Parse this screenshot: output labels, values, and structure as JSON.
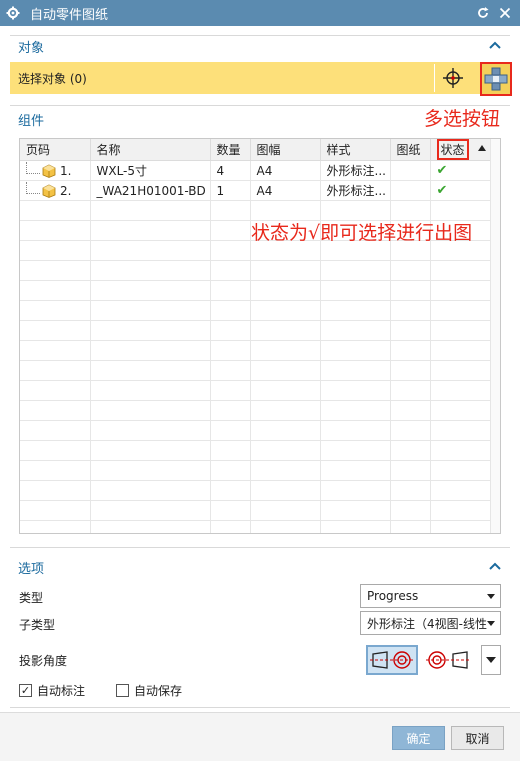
{
  "window": {
    "title": "自动零件图纸",
    "gear_icon": "gear-icon",
    "reset_icon": "reset-icon",
    "close_icon": "close-icon"
  },
  "object_section": {
    "label": "对象",
    "select_label": "选择对象 (0)"
  },
  "annotations": {
    "multi_select": "多选按钮",
    "status_hint": "状态为√即可选择进行出图"
  },
  "component_section": {
    "label": "组件",
    "columns": [
      "页码",
      "名称",
      "数量",
      "图幅",
      "样式",
      "图纸",
      "状态"
    ],
    "rows": [
      {
        "page": "1.",
        "name": "WXL-5寸",
        "qty": "4",
        "size": "A4",
        "style": "外形标注...",
        "drawing": "",
        "status": "✔"
      },
      {
        "page": "2.",
        "name": "_WA21H01001-BD",
        "qty": "1",
        "size": "A4",
        "style": "外形标注...",
        "drawing": "",
        "status": "✔"
      }
    ]
  },
  "options_section": {
    "label": "选项",
    "type_label": "类型",
    "type_value": "Progress",
    "subtype_label": "子类型",
    "subtype_value": "外形标注（4视图-线性",
    "proj_label": "投影角度",
    "auto_annotate_label": "自动标注",
    "auto_save_label": "自动保存"
  },
  "footer": {
    "ok_label": "确定",
    "cancel_label": "取消"
  },
  "colors": {
    "title_bar": "#5b8bb0",
    "accent_text": "#1b6a9e",
    "selection_fill": "#fde07a",
    "annotation_red": "#e8291c",
    "check_green": "#3aa530",
    "ok_button": "#8fb6d6"
  }
}
